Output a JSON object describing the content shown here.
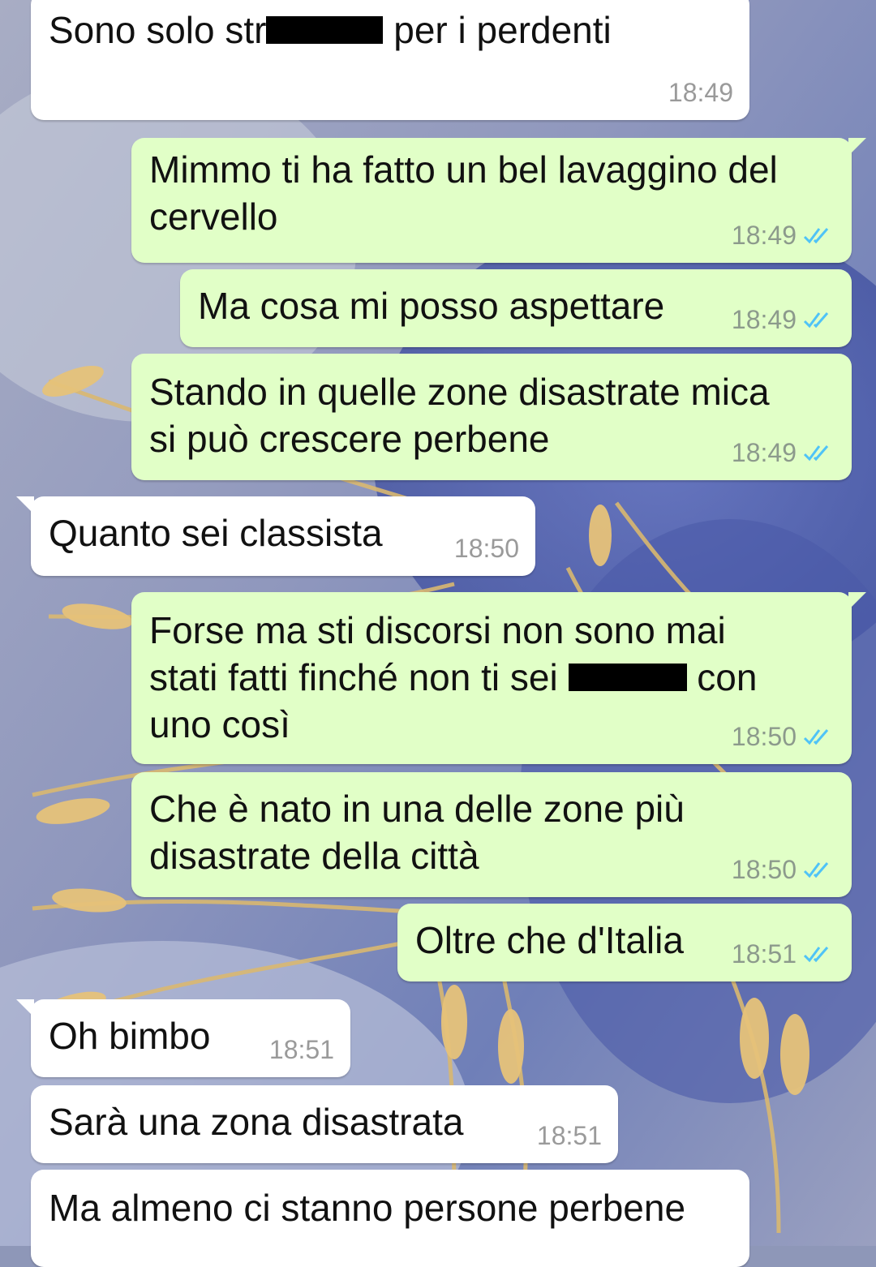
{
  "colors": {
    "incoming_bubble": "#ffffff",
    "outgoing_bubble": "#e1ffc7",
    "read_ticks": "#4fc3f7",
    "timestamp": "#8c9a8c"
  },
  "messages": [
    {
      "direction": "in",
      "text_before": "Sono solo str",
      "redacted": true,
      "text_after": " per i perdenti",
      "time": "18:49"
    },
    {
      "direction": "out",
      "lines": [
        "Mimmo ti ha fatto un bel lavaggino del",
        "cervello"
      ],
      "time": "18:49",
      "status_icon": "double-check-read-icon"
    },
    {
      "direction": "out",
      "lines": [
        "Ma cosa mi posso aspettare"
      ],
      "time": "18:49",
      "status_icon": "double-check-read-icon"
    },
    {
      "direction": "out",
      "lines": [
        "Stando in quelle zone disastrate mica",
        "si può crescere perbene"
      ],
      "time": "18:49",
      "status_icon": "double-check-read-icon"
    },
    {
      "direction": "in",
      "lines": [
        "Quanto sei classista"
      ],
      "time": "18:50"
    },
    {
      "direction": "out",
      "line1": "Forse ma sti discorsi non sono mai",
      "line2_before": "stati fatti finché non ti sei",
      "line2_after": "con",
      "line3": "uno così",
      "time": "18:50",
      "status_icon": "double-check-read-icon"
    },
    {
      "direction": "out",
      "lines": [
        "Che è nato in una delle zone più",
        "disastrate della città"
      ],
      "time": "18:50",
      "status_icon": "double-check-read-icon"
    },
    {
      "direction": "out",
      "lines": [
        "Oltre che d'Italia"
      ],
      "time": "18:51",
      "status_icon": "double-check-read-icon"
    },
    {
      "direction": "in",
      "lines": [
        "Oh bimbo"
      ],
      "time": "18:51"
    },
    {
      "direction": "in",
      "lines": [
        "Sarà una zona disastrata"
      ],
      "time": "18:51"
    },
    {
      "direction": "in",
      "lines": [
        "Ma almeno ci stanno persone perbene"
      ],
      "time": ""
    }
  ]
}
